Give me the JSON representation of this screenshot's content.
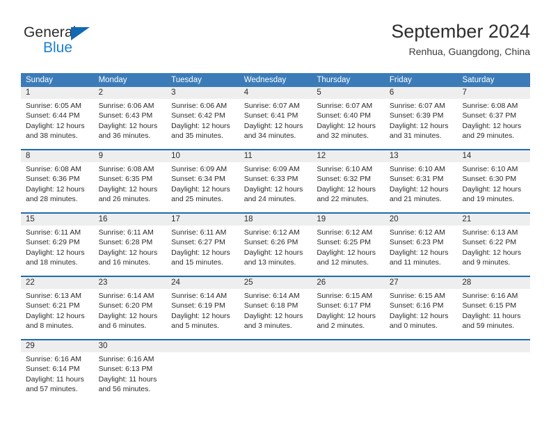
{
  "brand": {
    "name_top": "General",
    "name_bottom": "Blue",
    "accent_color": "#1268b3",
    "blue_text_color": "#1b7fd4"
  },
  "header": {
    "title": "September 2024",
    "subtitle": "Renhua, Guangdong, China"
  },
  "colors": {
    "header_blue": "#3b7cb8",
    "week_rule_blue": "#1d6ab0",
    "daynum_band": "#eeeeee",
    "text": "#2a2a2a"
  },
  "weekdays": [
    "Sunday",
    "Monday",
    "Tuesday",
    "Wednesday",
    "Thursday",
    "Friday",
    "Saturday"
  ],
  "weeks": [
    {
      "days": [
        {
          "num": "1",
          "sunrise": "Sunrise: 6:05 AM",
          "sunset": "Sunset: 6:44 PM",
          "daylight1": "Daylight: 12 hours",
          "daylight2": "and 38 minutes."
        },
        {
          "num": "2",
          "sunrise": "Sunrise: 6:06 AM",
          "sunset": "Sunset: 6:43 PM",
          "daylight1": "Daylight: 12 hours",
          "daylight2": "and 36 minutes."
        },
        {
          "num": "3",
          "sunrise": "Sunrise: 6:06 AM",
          "sunset": "Sunset: 6:42 PM",
          "daylight1": "Daylight: 12 hours",
          "daylight2": "and 35 minutes."
        },
        {
          "num": "4",
          "sunrise": "Sunrise: 6:07 AM",
          "sunset": "Sunset: 6:41 PM",
          "daylight1": "Daylight: 12 hours",
          "daylight2": "and 34 minutes."
        },
        {
          "num": "5",
          "sunrise": "Sunrise: 6:07 AM",
          "sunset": "Sunset: 6:40 PM",
          "daylight1": "Daylight: 12 hours",
          "daylight2": "and 32 minutes."
        },
        {
          "num": "6",
          "sunrise": "Sunrise: 6:07 AM",
          "sunset": "Sunset: 6:39 PM",
          "daylight1": "Daylight: 12 hours",
          "daylight2": "and 31 minutes."
        },
        {
          "num": "7",
          "sunrise": "Sunrise: 6:08 AM",
          "sunset": "Sunset: 6:37 PM",
          "daylight1": "Daylight: 12 hours",
          "daylight2": "and 29 minutes."
        }
      ]
    },
    {
      "days": [
        {
          "num": "8",
          "sunrise": "Sunrise: 6:08 AM",
          "sunset": "Sunset: 6:36 PM",
          "daylight1": "Daylight: 12 hours",
          "daylight2": "and 28 minutes."
        },
        {
          "num": "9",
          "sunrise": "Sunrise: 6:08 AM",
          "sunset": "Sunset: 6:35 PM",
          "daylight1": "Daylight: 12 hours",
          "daylight2": "and 26 minutes."
        },
        {
          "num": "10",
          "sunrise": "Sunrise: 6:09 AM",
          "sunset": "Sunset: 6:34 PM",
          "daylight1": "Daylight: 12 hours",
          "daylight2": "and 25 minutes."
        },
        {
          "num": "11",
          "sunrise": "Sunrise: 6:09 AM",
          "sunset": "Sunset: 6:33 PM",
          "daylight1": "Daylight: 12 hours",
          "daylight2": "and 24 minutes."
        },
        {
          "num": "12",
          "sunrise": "Sunrise: 6:10 AM",
          "sunset": "Sunset: 6:32 PM",
          "daylight1": "Daylight: 12 hours",
          "daylight2": "and 22 minutes."
        },
        {
          "num": "13",
          "sunrise": "Sunrise: 6:10 AM",
          "sunset": "Sunset: 6:31 PM",
          "daylight1": "Daylight: 12 hours",
          "daylight2": "and 21 minutes."
        },
        {
          "num": "14",
          "sunrise": "Sunrise: 6:10 AM",
          "sunset": "Sunset: 6:30 PM",
          "daylight1": "Daylight: 12 hours",
          "daylight2": "and 19 minutes."
        }
      ]
    },
    {
      "days": [
        {
          "num": "15",
          "sunrise": "Sunrise: 6:11 AM",
          "sunset": "Sunset: 6:29 PM",
          "daylight1": "Daylight: 12 hours",
          "daylight2": "and 18 minutes."
        },
        {
          "num": "16",
          "sunrise": "Sunrise: 6:11 AM",
          "sunset": "Sunset: 6:28 PM",
          "daylight1": "Daylight: 12 hours",
          "daylight2": "and 16 minutes."
        },
        {
          "num": "17",
          "sunrise": "Sunrise: 6:11 AM",
          "sunset": "Sunset: 6:27 PM",
          "daylight1": "Daylight: 12 hours",
          "daylight2": "and 15 minutes."
        },
        {
          "num": "18",
          "sunrise": "Sunrise: 6:12 AM",
          "sunset": "Sunset: 6:26 PM",
          "daylight1": "Daylight: 12 hours",
          "daylight2": "and 13 minutes."
        },
        {
          "num": "19",
          "sunrise": "Sunrise: 6:12 AM",
          "sunset": "Sunset: 6:25 PM",
          "daylight1": "Daylight: 12 hours",
          "daylight2": "and 12 minutes."
        },
        {
          "num": "20",
          "sunrise": "Sunrise: 6:12 AM",
          "sunset": "Sunset: 6:23 PM",
          "daylight1": "Daylight: 12 hours",
          "daylight2": "and 11 minutes."
        },
        {
          "num": "21",
          "sunrise": "Sunrise: 6:13 AM",
          "sunset": "Sunset: 6:22 PM",
          "daylight1": "Daylight: 12 hours",
          "daylight2": "and 9 minutes."
        }
      ]
    },
    {
      "days": [
        {
          "num": "22",
          "sunrise": "Sunrise: 6:13 AM",
          "sunset": "Sunset: 6:21 PM",
          "daylight1": "Daylight: 12 hours",
          "daylight2": "and 8 minutes."
        },
        {
          "num": "23",
          "sunrise": "Sunrise: 6:14 AM",
          "sunset": "Sunset: 6:20 PM",
          "daylight1": "Daylight: 12 hours",
          "daylight2": "and 6 minutes."
        },
        {
          "num": "24",
          "sunrise": "Sunrise: 6:14 AM",
          "sunset": "Sunset: 6:19 PM",
          "daylight1": "Daylight: 12 hours",
          "daylight2": "and 5 minutes."
        },
        {
          "num": "25",
          "sunrise": "Sunrise: 6:14 AM",
          "sunset": "Sunset: 6:18 PM",
          "daylight1": "Daylight: 12 hours",
          "daylight2": "and 3 minutes."
        },
        {
          "num": "26",
          "sunrise": "Sunrise: 6:15 AM",
          "sunset": "Sunset: 6:17 PM",
          "daylight1": "Daylight: 12 hours",
          "daylight2": "and 2 minutes."
        },
        {
          "num": "27",
          "sunrise": "Sunrise: 6:15 AM",
          "sunset": "Sunset: 6:16 PM",
          "daylight1": "Daylight: 12 hours",
          "daylight2": "and 0 minutes."
        },
        {
          "num": "28",
          "sunrise": "Sunrise: 6:16 AM",
          "sunset": "Sunset: 6:15 PM",
          "daylight1": "Daylight: 11 hours",
          "daylight2": "and 59 minutes."
        }
      ]
    },
    {
      "days": [
        {
          "num": "29",
          "sunrise": "Sunrise: 6:16 AM",
          "sunset": "Sunset: 6:14 PM",
          "daylight1": "Daylight: 11 hours",
          "daylight2": "and 57 minutes."
        },
        {
          "num": "30",
          "sunrise": "Sunrise: 6:16 AM",
          "sunset": "Sunset: 6:13 PM",
          "daylight1": "Daylight: 11 hours",
          "daylight2": "and 56 minutes."
        },
        {
          "num": "",
          "sunrise": "",
          "sunset": "",
          "daylight1": "",
          "daylight2": ""
        },
        {
          "num": "",
          "sunrise": "",
          "sunset": "",
          "daylight1": "",
          "daylight2": ""
        },
        {
          "num": "",
          "sunrise": "",
          "sunset": "",
          "daylight1": "",
          "daylight2": ""
        },
        {
          "num": "",
          "sunrise": "",
          "sunset": "",
          "daylight1": "",
          "daylight2": ""
        },
        {
          "num": "",
          "sunrise": "",
          "sunset": "",
          "daylight1": "",
          "daylight2": ""
        }
      ]
    }
  ]
}
